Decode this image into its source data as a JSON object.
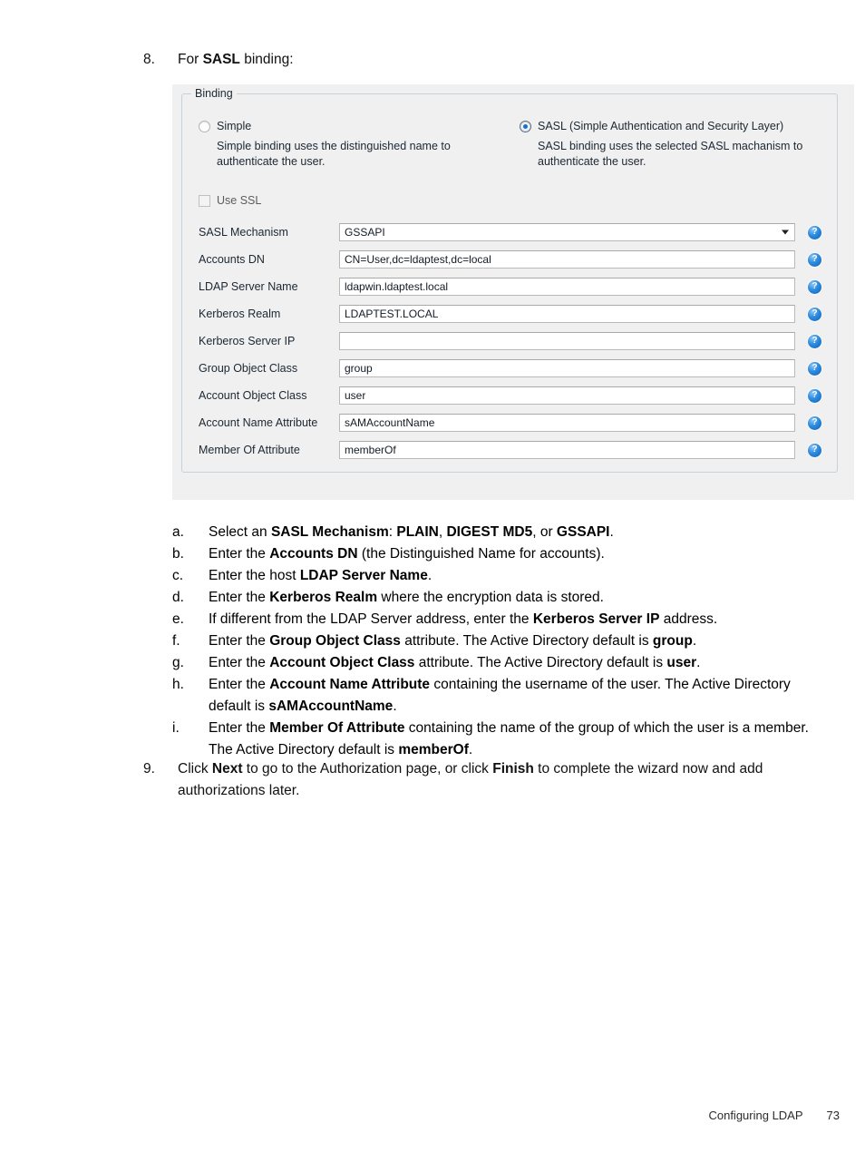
{
  "steps": {
    "step8": {
      "number": "8.",
      "text_before": "For ",
      "bold": "SASL",
      "text_after": " binding:"
    },
    "step9": {
      "number": "9.",
      "part1": "Click ",
      "bold1": "Next",
      "part2": " to go to the Authorization page, or click ",
      "bold2": "Finish",
      "part3": " to complete the wizard now and add authorizations later."
    }
  },
  "dialog": {
    "groupbox_title": "Binding",
    "simple": {
      "label": "Simple",
      "selected": false,
      "description": "Simple binding uses the distinguished name to authenticate the user."
    },
    "sasl": {
      "label": "SASL (Simple Authentication and Security Layer)",
      "selected": true,
      "description": "SASL binding uses the selected SASL machanism to authenticate the user."
    },
    "use_ssl": {
      "label": "Use SSL",
      "checked": false
    },
    "help_icon_name": "help-icon",
    "help_icon_glyph": "?",
    "fields": [
      {
        "label": "SASL Mechanism",
        "value": "GSSAPI",
        "type": "combobox"
      },
      {
        "label": "Accounts DN",
        "value": "CN=User,dc=ldaptest,dc=local",
        "type": "text"
      },
      {
        "label": "LDAP Server Name",
        "value": "ldapwin.ldaptest.local",
        "type": "text"
      },
      {
        "label": "Kerberos Realm",
        "value": "LDAPTEST.LOCAL",
        "type": "text"
      },
      {
        "label": "Kerberos Server IP",
        "value": "",
        "type": "text"
      },
      {
        "label": "Group Object Class",
        "value": "group",
        "type": "text"
      },
      {
        "label": "Account Object Class",
        "value": "user",
        "type": "text"
      },
      {
        "label": "Account Name Attribute",
        "value": "sAMAccountName",
        "type": "text"
      },
      {
        "label": "Member Of Attribute",
        "value": "memberOf",
        "type": "text"
      }
    ]
  },
  "sublist": [
    {
      "letter": "a.",
      "segments": [
        {
          "t": "Select an ",
          "b": false
        },
        {
          "t": "SASL Mechanism",
          "b": true
        },
        {
          "t": ": ",
          "b": false
        },
        {
          "t": "PLAIN",
          "b": true
        },
        {
          "t": ", ",
          "b": false
        },
        {
          "t": "DIGEST MD5",
          "b": true
        },
        {
          "t": ", or ",
          "b": false
        },
        {
          "t": "GSSAPI",
          "b": true
        },
        {
          "t": ".",
          "b": false
        }
      ]
    },
    {
      "letter": "b.",
      "segments": [
        {
          "t": "Enter the ",
          "b": false
        },
        {
          "t": "Accounts DN",
          "b": true
        },
        {
          "t": " (the Distinguished Name for accounts).",
          "b": false
        }
      ]
    },
    {
      "letter": "c.",
      "segments": [
        {
          "t": "Enter the host ",
          "b": false
        },
        {
          "t": "LDAP Server Name",
          "b": true
        },
        {
          "t": ".",
          "b": false
        }
      ]
    },
    {
      "letter": "d.",
      "segments": [
        {
          "t": "Enter the ",
          "b": false
        },
        {
          "t": "Kerberos Realm",
          "b": true
        },
        {
          "t": " where the encryption data is stored.",
          "b": false
        }
      ]
    },
    {
      "letter": "e.",
      "segments": [
        {
          "t": "If different from the LDAP Server address, enter the ",
          "b": false
        },
        {
          "t": "Kerberos Server IP",
          "b": true
        },
        {
          "t": " address.",
          "b": false
        }
      ]
    },
    {
      "letter": "f.",
      "segments": [
        {
          "t": "Enter the ",
          "b": false
        },
        {
          "t": "Group Object Class",
          "b": true
        },
        {
          "t": " attribute. The Active Directory default is ",
          "b": false
        },
        {
          "t": "group",
          "b": true
        },
        {
          "t": ".",
          "b": false
        }
      ]
    },
    {
      "letter": "g.",
      "segments": [
        {
          "t": "Enter the ",
          "b": false
        },
        {
          "t": "Account Object Class",
          "b": true
        },
        {
          "t": " attribute. The Active Directory default is ",
          "b": false
        },
        {
          "t": "user",
          "b": true
        },
        {
          "t": ".",
          "b": false
        }
      ]
    },
    {
      "letter": "h.",
      "segments": [
        {
          "t": "Enter the ",
          "b": false
        },
        {
          "t": "Account Name Attribute",
          "b": true
        },
        {
          "t": " containing the username of the user. The Active Directory default is ",
          "b": false
        },
        {
          "t": "sAMAccountName",
          "b": true
        },
        {
          "t": ".",
          "b": false
        }
      ]
    },
    {
      "letter": "i.",
      "segments": [
        {
          "t": "Enter the ",
          "b": false
        },
        {
          "t": "Member Of Attribute",
          "b": true
        },
        {
          "t": " containing the name of the group of which the user is a member. The Active Directory default is ",
          "b": false
        },
        {
          "t": "memberOf",
          "b": true
        },
        {
          "t": ".",
          "b": false
        }
      ]
    }
  ],
  "footer": {
    "title": "Configuring LDAP",
    "page_number": "73"
  },
  "colors": {
    "panel_bg": "#f0f0f0",
    "field_bg": "#ffffff",
    "help_blue": "#2f8ee0",
    "radio_dot": "#1a6fc4",
    "text": "#1b2733"
  }
}
